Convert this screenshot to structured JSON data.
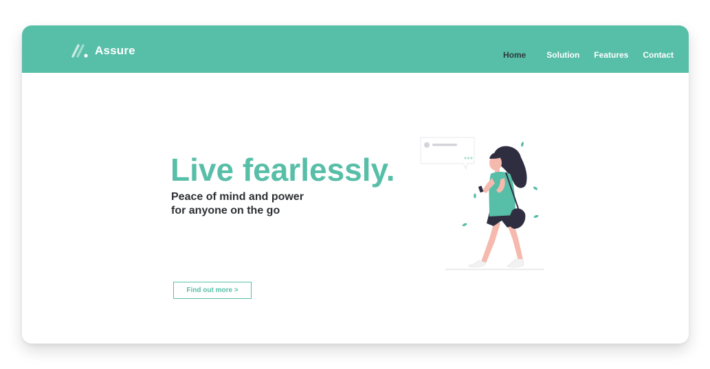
{
  "brand": {
    "name": "Assure",
    "accent_color": "#57bea8",
    "logo_icon": "slash-dot-logo-icon"
  },
  "nav": {
    "items": [
      {
        "label": "Home",
        "active": true
      },
      {
        "label": "Solution",
        "active": false
      },
      {
        "label": "Features",
        "active": false
      },
      {
        "label": "Contact",
        "active": false
      }
    ]
  },
  "hero": {
    "title": "Live fearlessly.",
    "subtitle_line1": "Peace of mind and power",
    "subtitle_line2": "for anyone on the go",
    "cta_label": "Find out more >",
    "illustration_icon": "woman-walking-with-phone-illustration"
  }
}
